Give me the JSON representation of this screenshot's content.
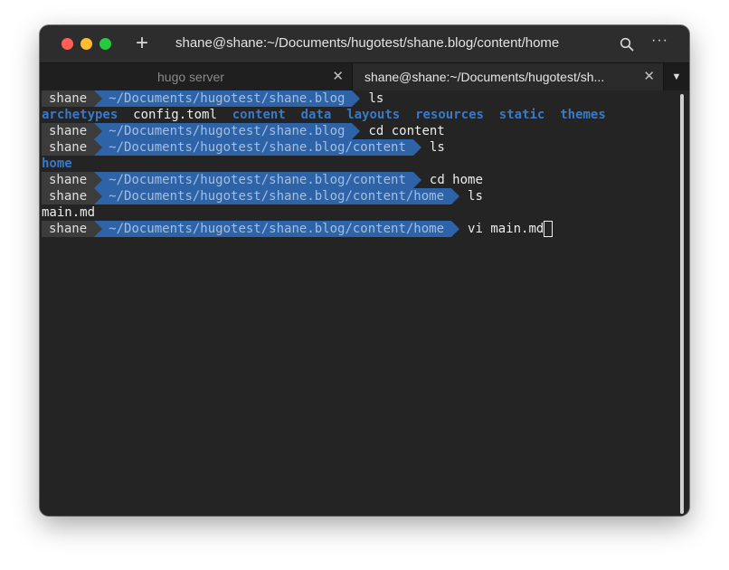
{
  "window": {
    "title": "shane@shane:~/Documents/hugotest/shane.blog/content/home"
  },
  "tabs": [
    {
      "label": "hugo server",
      "active": false
    },
    {
      "label": "shane@shane:~/Documents/hugotest/sh...",
      "active": true
    }
  ],
  "terminal": {
    "user": "shane",
    "lines": [
      {
        "path": "~/Documents/hugotest/shane.blog",
        "command": "ls"
      },
      {
        "output": [
          "archetypes",
          "config.toml",
          "content",
          "data",
          "layouts",
          "resources",
          "static",
          "themes"
        ]
      },
      {
        "path": "~/Documents/hugotest/shane.blog",
        "command": "cd content"
      },
      {
        "path": "~/Documents/hugotest/shane.blog/content",
        "command": "ls"
      },
      {
        "output": [
          "home"
        ]
      },
      {
        "path": "~/Documents/hugotest/shane.blog/content",
        "command": "cd home"
      },
      {
        "path": "~/Documents/hugotest/shane.blog/content/home",
        "command": "ls"
      },
      {
        "output": [
          "main.md"
        ]
      },
      {
        "path": "~/Documents/hugotest/shane.blog/content/home",
        "command": "vi main.md"
      }
    ]
  },
  "colors": {
    "prompt_user_bg": "#3c3c3c",
    "prompt_path_bg": "#2e63a8",
    "directory": "#3a79c8",
    "background": "#242424"
  },
  "icons": {
    "new_tab": "plus-icon",
    "search": "search-icon",
    "menu": "more-icon",
    "tab_close": "close-icon",
    "tab_dropdown": "chevron-down-icon"
  }
}
